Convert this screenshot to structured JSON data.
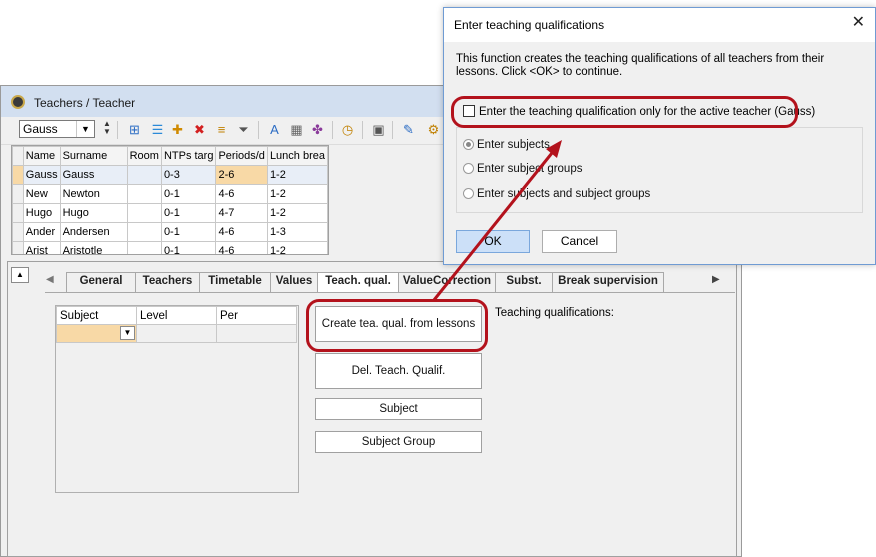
{
  "main_window": {
    "title": "Teachers / Teacher",
    "toolbar": {
      "teacher_combo_value": "Gauss",
      "buttons": [
        {
          "icon": "grid-list-icon",
          "glyph": "⊞",
          "color": "#2b6cc4"
        },
        {
          "icon": "grid-rows-icon",
          "glyph": "☰",
          "color": "#2b8ad8"
        },
        {
          "icon": "new-record-icon",
          "glyph": "✚",
          "color": "#d08a00"
        },
        {
          "icon": "delete-icon",
          "glyph": "✖",
          "color": "#d32020"
        },
        {
          "icon": "sort-icon",
          "glyph": "≡",
          "color": "#c08000"
        },
        {
          "icon": "filter-icon",
          "glyph": "⏷",
          "color": "#555555"
        },
        {
          "icon": "spellcheck-icon",
          "glyph": "A",
          "color": "#2b6cc4"
        },
        {
          "icon": "field-layout-icon",
          "glyph": "▦",
          "color": "#666666"
        },
        {
          "icon": "share-icon",
          "glyph": "✤",
          "color": "#8a3a9a"
        },
        {
          "icon": "clock-icon",
          "glyph": "◷",
          "color": "#c08000"
        },
        {
          "icon": "settings-panel-icon",
          "glyph": "▣",
          "color": "#555555"
        },
        {
          "icon": "brush-icon",
          "glyph": "✎",
          "color": "#2b6cc4"
        },
        {
          "icon": "gear-icon",
          "glyph": "⚙",
          "color": "#c08000"
        }
      ]
    },
    "grid": {
      "columns": [
        "Name",
        "Surname",
        "Room",
        "NTPs targ",
        "Periods/d",
        "Lunch brea"
      ],
      "rows": [
        [
          "Gauss",
          "Gauss",
          "",
          "0-3",
          "2-6",
          "1-2"
        ],
        [
          "New",
          "Newton",
          "",
          "0-1",
          "4-6",
          "1-2"
        ],
        [
          "Hugo",
          "Hugo",
          "",
          "0-1",
          "4-7",
          "1-2"
        ],
        [
          "Ander",
          "Andersen",
          "",
          "0-1",
          "4-6",
          "1-3"
        ],
        [
          "Arist",
          "Aristotle",
          "",
          "0-1",
          "4-6",
          "1-2"
        ]
      ]
    },
    "tabs": [
      "General",
      "Teachers",
      "Timetable",
      "Values",
      "Teach. qual.",
      "ValueCorrection",
      "Subst.",
      "Break supervision"
    ],
    "active_tab": "Teach. qual.",
    "qual_table": {
      "columns": [
        "Subject",
        "Level",
        "Per"
      ]
    },
    "buttons": {
      "create": "Create tea. qual. from lessons",
      "delete": "Del. Teach. Qualif.",
      "subject": "Subject",
      "subject_group": "Subject Group"
    },
    "teaching_qualifications_label": "Teaching qualifications:"
  },
  "dialog": {
    "title": "Enter teaching qualifications",
    "message": "This function creates the teaching qualifications of all teachers from their lessons. Click <OK> to continue.",
    "checkbox_label": "Enter the teaching qualification only for the active teacher (Gauss)",
    "checkbox_checked": false,
    "radio_options": [
      "Enter subjects",
      "Enter subject groups",
      "Enter subjects and subject groups"
    ],
    "radio_selected": 0,
    "ok_label": "OK",
    "cancel_label": "Cancel"
  },
  "colors": {
    "highlight_red": "#b3121c",
    "selection_orange": "#f8d9a6",
    "titlebar_blue": "#d2dff0"
  }
}
